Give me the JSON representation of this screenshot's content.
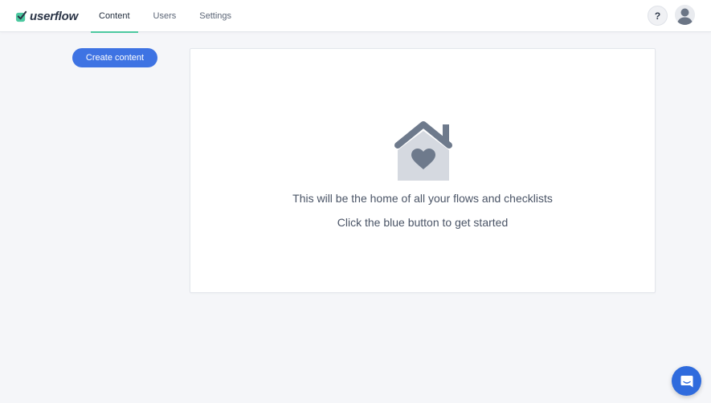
{
  "app": {
    "brand": "userflow",
    "brand_color": "#3e73e3",
    "accent_color": "#4cc9a0"
  },
  "nav": {
    "tabs": [
      {
        "label": "Content",
        "active": true
      },
      {
        "label": "Users",
        "active": false
      },
      {
        "label": "Settings",
        "active": false
      }
    ]
  },
  "header": {
    "help_label": "?",
    "help_icon": "question-icon",
    "avatar_icon": "user-avatar-icon"
  },
  "sidebar": {
    "create_label": "Create content"
  },
  "empty_state": {
    "icon": "house-heart-icon",
    "line1": "This will be the home of all your flows and checklists",
    "line2": "Click the blue button to get started"
  },
  "chat": {
    "icon": "chat-icon"
  }
}
